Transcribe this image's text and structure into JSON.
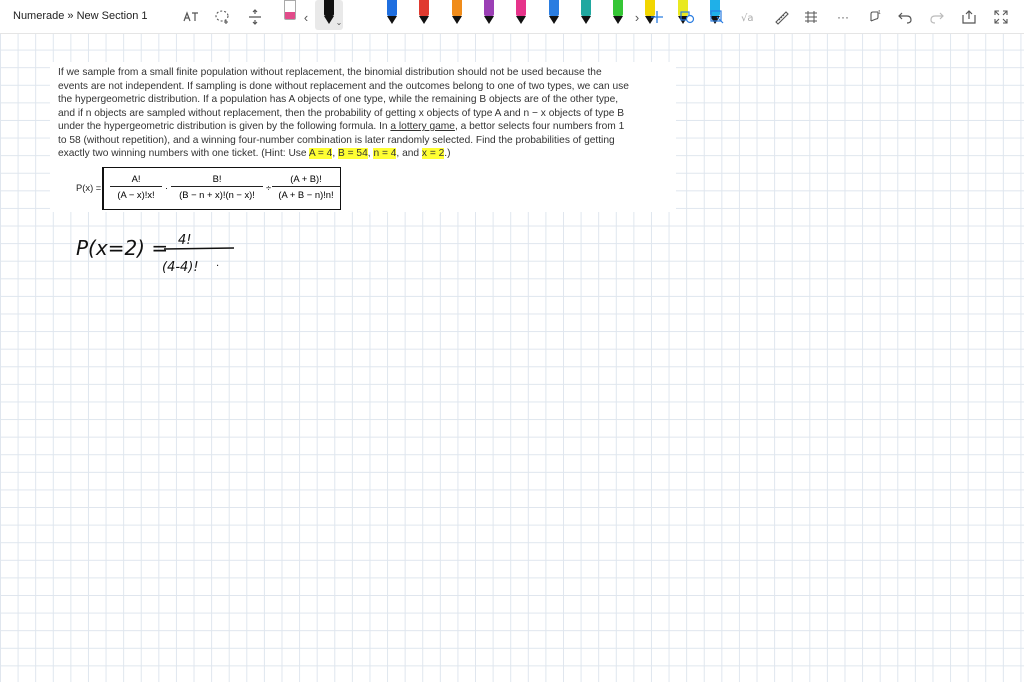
{
  "header": {
    "breadcrumb": "Numerade » New Section 1"
  },
  "toolbar": {
    "pens": [
      {
        "color": "#1a1a1a"
      },
      {
        "color": "#111111"
      },
      {
        "color": "#1f6fe0"
      },
      {
        "color": "#e03a2f"
      },
      {
        "color": "#f08c1a"
      },
      {
        "color": "#9b3fb5"
      },
      {
        "color": "#e6338a"
      },
      {
        "color": "#2a7de1"
      },
      {
        "color": "#20a8a0"
      },
      {
        "color": "#35c635"
      },
      {
        "color": "#f2d600"
      },
      {
        "color": "#e9e920"
      },
      {
        "color": "#1fb0e8"
      }
    ],
    "highlight_color": "#ffff33"
  },
  "problem": {
    "text_line1": "If we sample from a small finite population without replacement, the binomial distribution should not be used because the",
    "text_line2": "events are not independent. If sampling is done without replacement and the outcomes belong to one of two types, we can use",
    "text_line3": "the hypergeometric distribution. If a population has A objects of one type, while the remaining B objects are of the other type,",
    "text_line4": "and if n objects are sampled without replacement, then the probability of getting x objects of type A and n − x objects of type B",
    "text_line5": "under the hypergeometric distribution is given by the following formula. In ",
    "text_line5_link": "a lottery game",
    "text_line5_end": ", a bettor selects four numbers from 1",
    "text_line6": "to 58 (without repetition), and a winning four-number combination is later randomly selected. Find the probabilities of getting",
    "text_line7": "exactly two winning numbers with one ticket. (Hint: Use ",
    "hint_a": "A = 4",
    "hint_b": "B = 54",
    "hint_n": "n = 4",
    "hint_and": "and",
    "hint_x": "x = 2",
    "hint_close": ".)",
    "formula_label": "P(x) =",
    "frac1_num": "A!",
    "frac1_den": "(A − x)!x!",
    "frac2_num": "B!",
    "frac2_den": "(B − n + x)!(n − x)!",
    "frac3_num": "(A + B)!",
    "frac3_den": "(A + B − n)!n!",
    "op_mult": "·",
    "op_div": "÷"
  },
  "handwriting": {
    "lhs": "P(x=2) =",
    "numerator": "4!",
    "denominator": "(4-4)!",
    "trailing": "·"
  }
}
